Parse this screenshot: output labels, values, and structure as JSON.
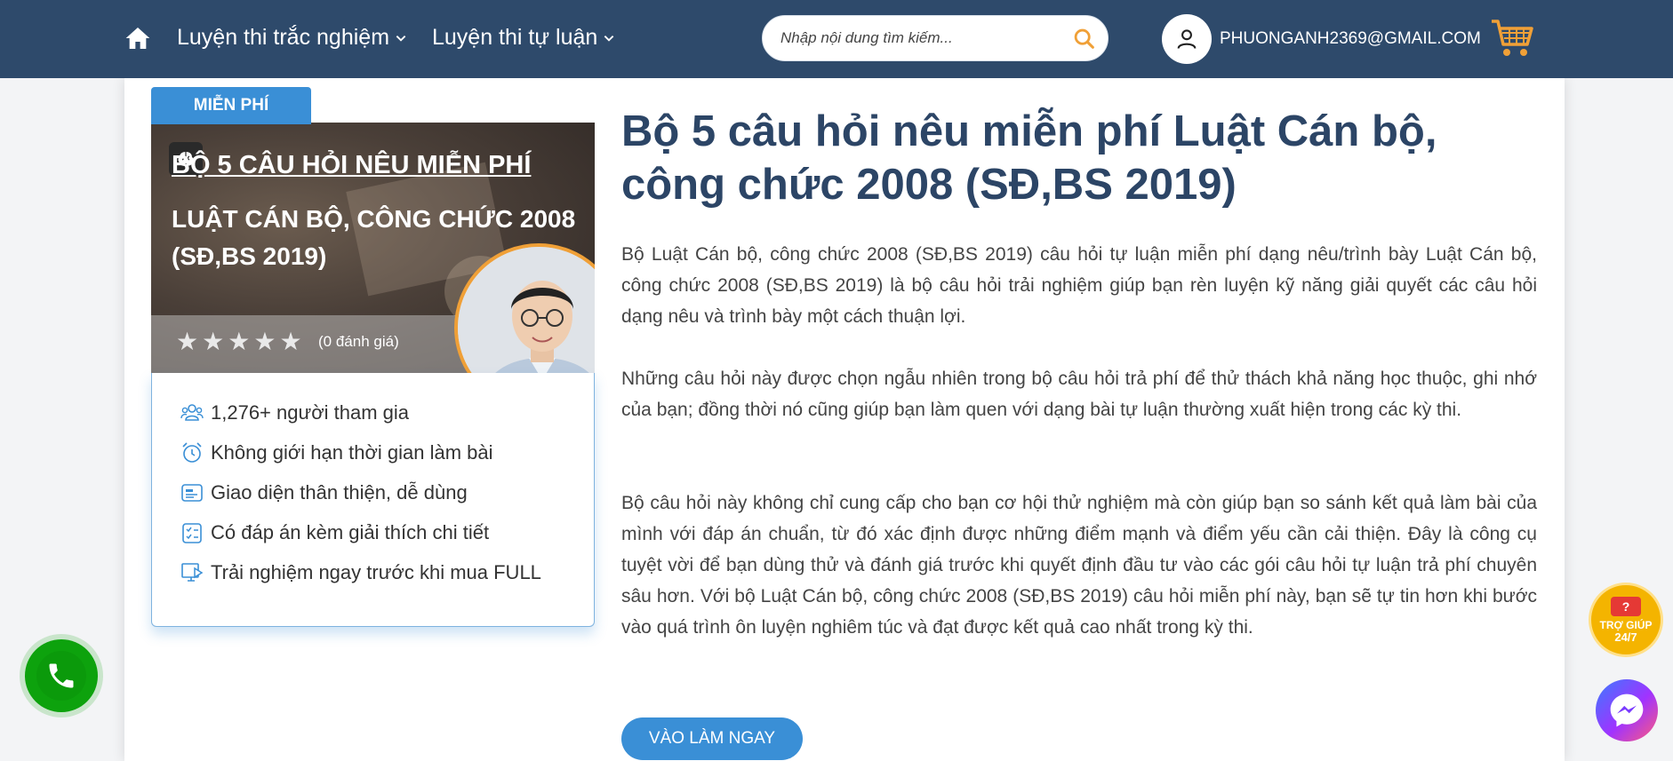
{
  "nav": {
    "home_icon": "home-icon",
    "items": [
      {
        "label": "Luyện thi trắc nghiệm"
      },
      {
        "label": "Luyện thi tự luận"
      }
    ],
    "search_placeholder": "Nhập nội dung tìm kiếm...",
    "user_email": "PHUONGANH2369@GMAIL.COM",
    "colors": {
      "bar": "#2e4a6b",
      "accent": "#f0a037"
    }
  },
  "course": {
    "badge": "MIỄN PHÍ",
    "thumb_line1": "BỘ 5 CÂU HỎI NÊU MIỄN PHÍ",
    "thumb_line2": "LUẬT CÁN BỘ, CÔNG CHỨC 2008 (SĐ,BS 2019)",
    "stars": 0,
    "rating_count": "(0 đánh giá)",
    "features": [
      {
        "icon": "users-icon",
        "label": "1,276+ người tham gia"
      },
      {
        "icon": "alarm-clock-icon",
        "label": "Không giới hạn thời gian làm bài"
      },
      {
        "icon": "interface-icon",
        "label": "Giao diện thân thiện, dễ dùng"
      },
      {
        "icon": "checklist-icon",
        "label": "Có đáp án kèm giải thích chi tiết"
      },
      {
        "icon": "monitor-play-icon",
        "label": "Trải nghiệm ngay trước khi mua FULL"
      }
    ]
  },
  "content": {
    "title": "Bộ 5 câu hỏi nêu miễn phí Luật Cán bộ, công chức 2008 (SĐ,BS 2019)",
    "paragraphs": [
      "Bộ Luật Cán bộ, công chức 2008 (SĐ,BS 2019) câu hỏi tự luận miễn phí dạng nêu/trình bày Luật Cán bộ, công chức 2008 (SĐ,BS 2019) là bộ câu hỏi trải nghiệm giúp bạn rèn luyện kỹ năng giải quyết các câu hỏi dạng nêu và trình bày một cách thuận lợi.",
      "Những câu hỏi này được chọn ngẫu nhiên trong bộ câu hỏi trả phí để thử thách khả năng học thuộc, ghi nhớ của bạn; đồng thời nó cũng giúp bạn làm quen với dạng bài tự luận thường xuất hiện trong các kỳ thi.",
      "Bộ câu hỏi này không chỉ cung cấp cho bạn cơ hội thử nghiệm mà còn giúp bạn so sánh kết quả làm bài của mình với đáp án chuẩn, từ đó xác định được những điểm mạnh và điểm yếu cần cải thiện. Đây là công cụ tuyệt vời để bạn dùng thử và đánh giá trước khi quyết định đầu tư vào các gói câu hỏi tự luận trả phí chuyên sâu hơn. Với bộ Luật Cán bộ, công chức 2008 (SĐ,BS 2019) câu hỏi miễn phí này, bạn sẽ tự tin hơn khi bước vào quá trình ôn luyện nghiêm túc và đạt được kết quả cao nhất trong kỳ thi."
    ],
    "cta": "VÀO LÀM NGAY"
  },
  "widgets": {
    "help_line1": "TRỢ GIÚP",
    "help_line2": "24/7",
    "help_badge": "?"
  }
}
